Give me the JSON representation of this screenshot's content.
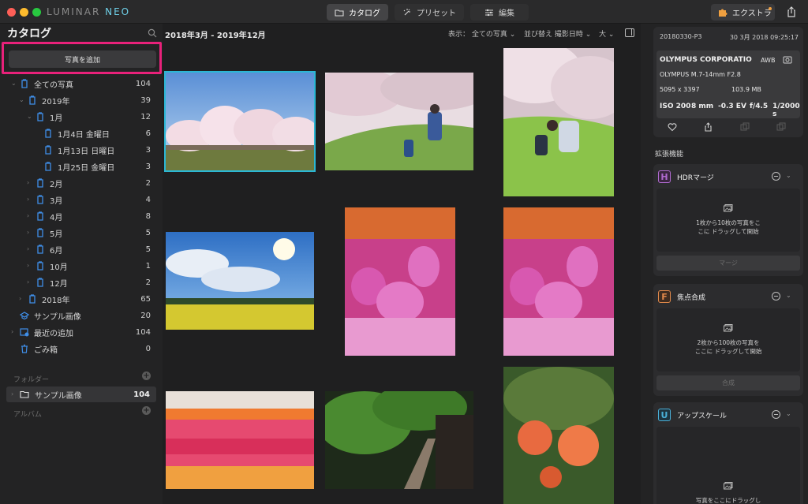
{
  "app": {
    "logo_a": "LUMINAR",
    "logo_b": "NEO"
  },
  "toolbar": {
    "tabs": [
      {
        "label": "カタログ",
        "icon": "folder-icon"
      },
      {
        "label": "プリセット",
        "icon": "sparkle-icon"
      },
      {
        "label": "編集",
        "icon": "sliders-icon"
      }
    ],
    "extra_label": "エクストラ"
  },
  "sidebar": {
    "title": "カタログ",
    "add_photos": "写真を追加",
    "tree": [
      {
        "label": "全ての写真",
        "count": "104"
      },
      {
        "label": "2019年",
        "count": "39"
      },
      {
        "label": "1月",
        "count": "12"
      },
      {
        "label": "1月4日 金曜日",
        "count": "6"
      },
      {
        "label": "1月13日 日曜日",
        "count": "3"
      },
      {
        "label": "1月25日 金曜日",
        "count": "3"
      },
      {
        "label": "2月",
        "count": "2"
      },
      {
        "label": "3月",
        "count": "4"
      },
      {
        "label": "4月",
        "count": "8"
      },
      {
        "label": "5月",
        "count": "5"
      },
      {
        "label": "6月",
        "count": "5"
      },
      {
        "label": "10月",
        "count": "1"
      },
      {
        "label": "12月",
        "count": "2"
      },
      {
        "label": "2018年",
        "count": "65"
      },
      {
        "label": "サンプル画像",
        "count": "20"
      },
      {
        "label": "最近の追加",
        "count": "104"
      },
      {
        "label": "ごみ箱",
        "count": "0"
      }
    ],
    "folders_header": "フォルダー",
    "folder_item": {
      "label": "サンプル画像",
      "count": "104"
    },
    "albums_header": "アルバム"
  },
  "main": {
    "date_range": "2018年3月 - 2019年12月",
    "show_label": "表示：",
    "show_value": "全ての写真",
    "sort_label": "並び替え",
    "sort_value": "撮影日時",
    "size_value": "大"
  },
  "info": {
    "filename": "20180330-P3",
    "date": "30 3月 2018 09:25:17",
    "camera": "OLYMPUS CORPORATIO",
    "wb": "AWB",
    "lens": "OLYMPUS M.7-14mm F2.8",
    "dimensions": "5095 x 3397",
    "filesize": "103.9 MB",
    "iso": "ISO 200",
    "focal": "8 mm",
    "ev": "-0.3 EV",
    "aperture": "f/4.5",
    "shutter": "1/2000 s"
  },
  "extensions": {
    "title": "拡張機能",
    "items": [
      {
        "badge": "H",
        "name": "HDRマージ",
        "drop_text_1": "1枚から10枚の写真をこ",
        "drop_text_2": "こに ドラッグして開始",
        "action": "マージ",
        "badge_color": "#b06ad0"
      },
      {
        "badge": "F",
        "name": "焦点合成",
        "drop_text_1": "2枚から100枚の写真を",
        "drop_text_2": "ここに ドラッグして開始",
        "action": "合成",
        "badge_color": "#e0884a"
      },
      {
        "badge": "U",
        "name": "アップスケール",
        "drop_text_1": "写真をここにドラッグし",
        "drop_text_2": "",
        "action": "",
        "badge_color": "#4ab0d8"
      }
    ]
  },
  "colors": {
    "accent": "#2bb7d4",
    "highlight": "#e8217a",
    "background": "#1f1f20"
  }
}
